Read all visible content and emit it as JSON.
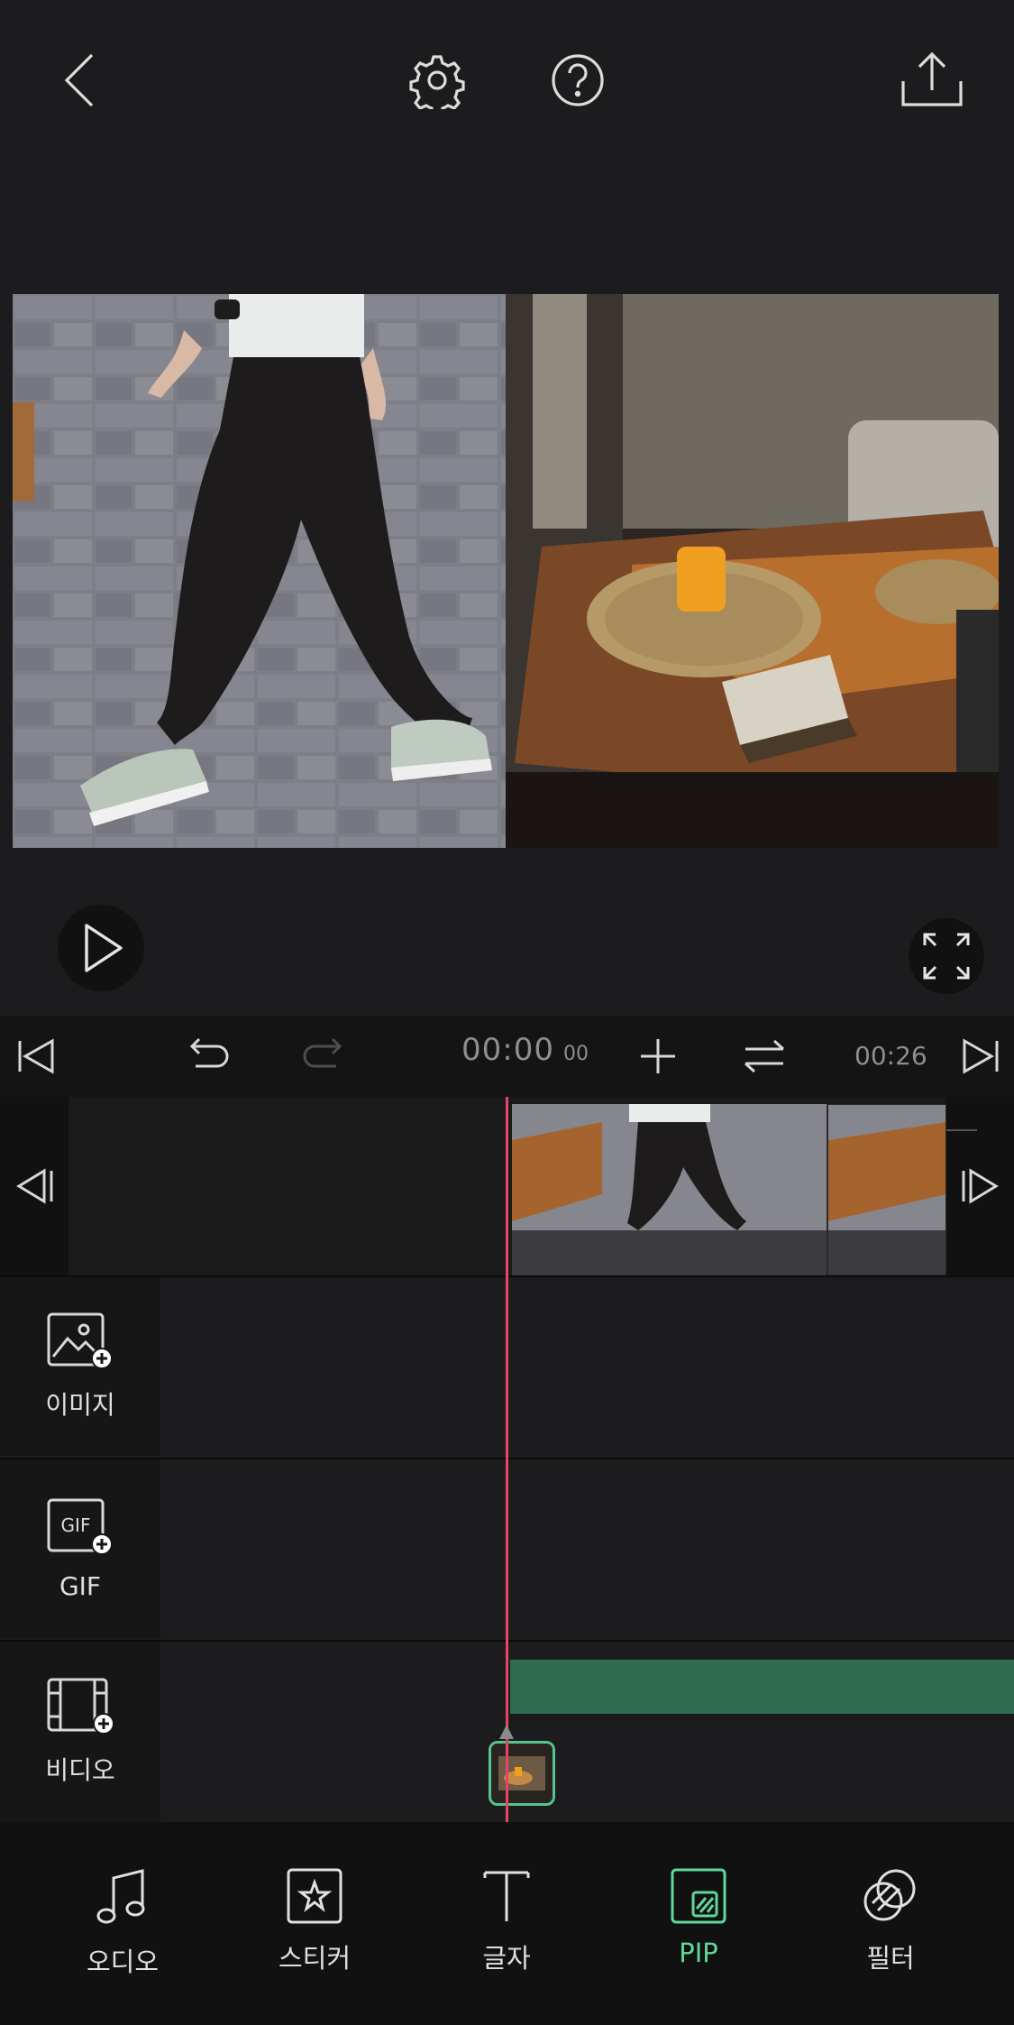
{
  "toolbar": {
    "timecode": "00:00",
    "timecode_frames": "00",
    "duration": "00:26"
  },
  "layers": [
    {
      "label": "이미지",
      "icon": "image-add-icon"
    },
    {
      "label": "GIF",
      "icon": "gif-add-icon"
    },
    {
      "label": "비디오",
      "icon": "video-add-icon"
    }
  ],
  "gif_icon_text": "GIF",
  "bottom_nav": [
    {
      "label": "오디오",
      "icon": "music-note-icon",
      "active": false
    },
    {
      "label": "스티커",
      "icon": "sticker-star-icon",
      "active": false
    },
    {
      "label": "글자",
      "icon": "text-t-icon",
      "active": false
    },
    {
      "label": "PIP",
      "icon": "pip-icon",
      "active": true
    },
    {
      "label": "필터",
      "icon": "filter-circles-icon",
      "active": false
    }
  ],
  "colors": {
    "background": "#1c1c1e",
    "accent": "#5fd89c",
    "playhead": "#e84565",
    "pip_bar": "#2f6b4f"
  }
}
